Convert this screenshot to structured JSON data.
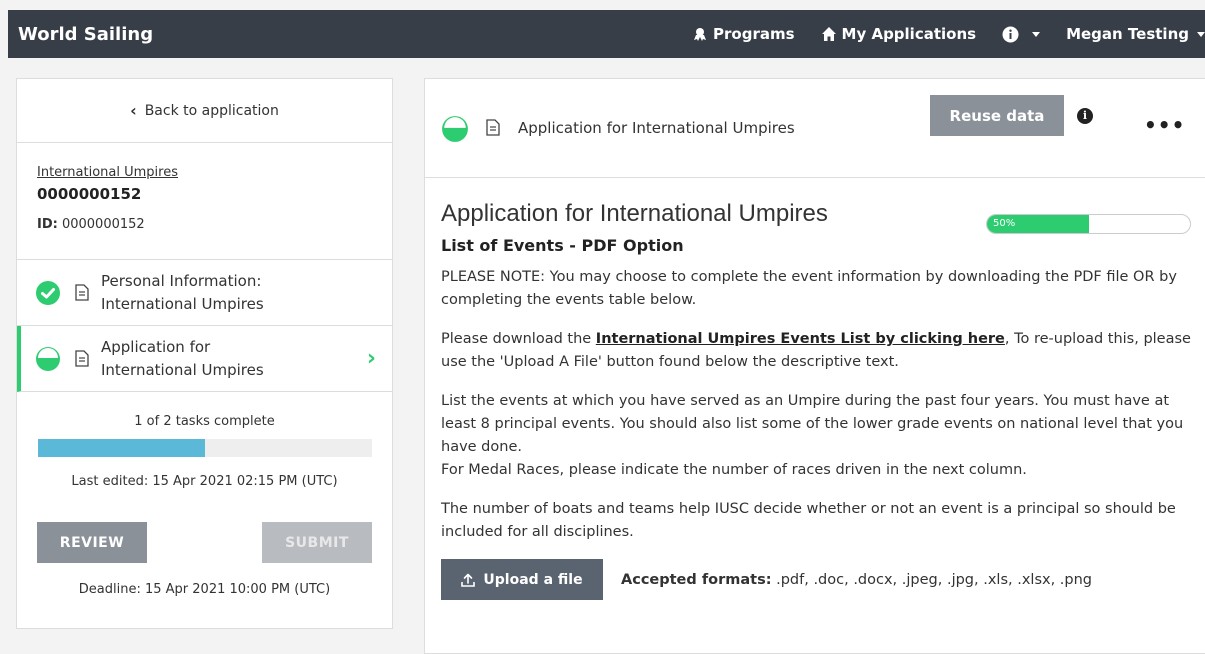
{
  "topbar": {
    "brand": "World Sailing",
    "programs_label": "Programs",
    "my_applications_label": "My Applications",
    "user_name": "Megan Testing"
  },
  "sidebar": {
    "back_label": "Back to application",
    "program_link": "International Umpires",
    "app_number": "0000000152",
    "id_label": "ID:",
    "id_value": "0000000152",
    "tasks": [
      {
        "line1": "Personal Information:",
        "line2": "International Umpires",
        "status": "complete"
      },
      {
        "line1": "Application for",
        "line2": "International Umpires",
        "status": "in-progress"
      }
    ],
    "tasks_complete": "1 of 2 tasks complete",
    "progress_fraction": 0.5,
    "last_edited": "Last edited: 15 Apr 2021 02:15 PM (UTC)",
    "review_label": "REVIEW",
    "submit_label": "SUBMIT",
    "deadline": "Deadline: 15 Apr 2021 10:00 PM (UTC)"
  },
  "main": {
    "header_title": "Application for International Umpires",
    "reuse_label": "Reuse data",
    "more_label": "•••",
    "page_title": "Application for International Umpires",
    "percent_label": "50%",
    "percent_value": 50,
    "section_title": "List of Events - PDF Option",
    "para1": "PLEASE NOTE: You may choose to complete the event information by downloading the PDF file OR by completing the events table below.",
    "para2_prefix": "Please download the ",
    "para2_link": "International Umpires Events List by clicking here",
    "para2_suffix": ", To re-upload this, please use the 'Upload A File' button found below the descriptive text.",
    "para3a": "List the events at which you have served as an Umpire during the past four years. You must have at least 8 principal events. You should also list some of the lower grade events on national level that you have done.",
    "para3b": "For Medal Races, please indicate the number of races driven in the next column.",
    "para4": "The number of boats and teams help IUSC decide whether or not an event is a principal so should be included for all disciplines.",
    "upload_label": "Upload a file",
    "formats_label": "Accepted formats:",
    "formats_value": " .pdf, .doc, .docx, .jpeg, .jpg, .xls, .xlsx, .png"
  },
  "colors": {
    "topbar": "#373e48",
    "accent_green": "#2ecc71",
    "progress_blue": "#5bb8d6",
    "button_gray": "#8a9199"
  }
}
